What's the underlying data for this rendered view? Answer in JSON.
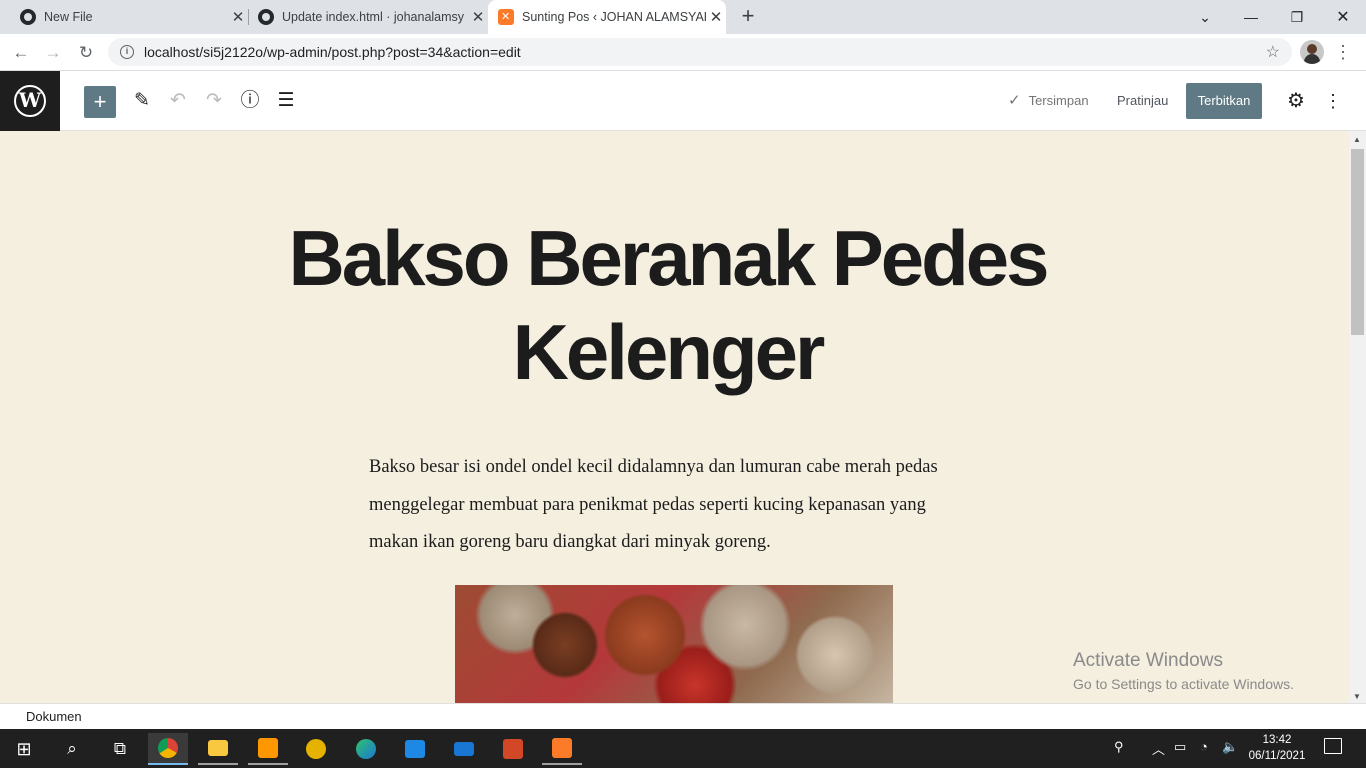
{
  "browser": {
    "tabs": [
      {
        "title": "New File",
        "icon": "github-icon"
      },
      {
        "title": "Update index.html · johanalamsy",
        "icon": "github-icon"
      },
      {
        "title": "Sunting Pos ‹ JOHAN ALAMSYAH",
        "icon": "xampp-icon"
      }
    ],
    "new_tab_label": "+",
    "url": "localhost/si5j2122o/wp-admin/post.php?post=34&action=edit"
  },
  "wp_toolbar": {
    "saved_label": "Tersimpan",
    "preview_label": "Pratinjau",
    "publish_label": "Terbitkan",
    "accent": "#5f7a84"
  },
  "post": {
    "title": "Bakso Beranak Pedes Kelenger",
    "paragraph": "Bakso besar isi ondel ondel kecil didalamnya dan lumuran cabe merah pedas menggelegar membuat para penikmat pedas seperti kucing kepanasan yang makan ikan goreng baru diangkat dari minyak goreng.",
    "background": "#f5efe0"
  },
  "footer": {
    "breadcrumb": "Dokumen"
  },
  "watermark": {
    "line1": "Activate Windows",
    "line2": "Go to Settings to activate Windows."
  },
  "taskbar": {
    "time": "13:42",
    "date": "06/11/2021"
  }
}
